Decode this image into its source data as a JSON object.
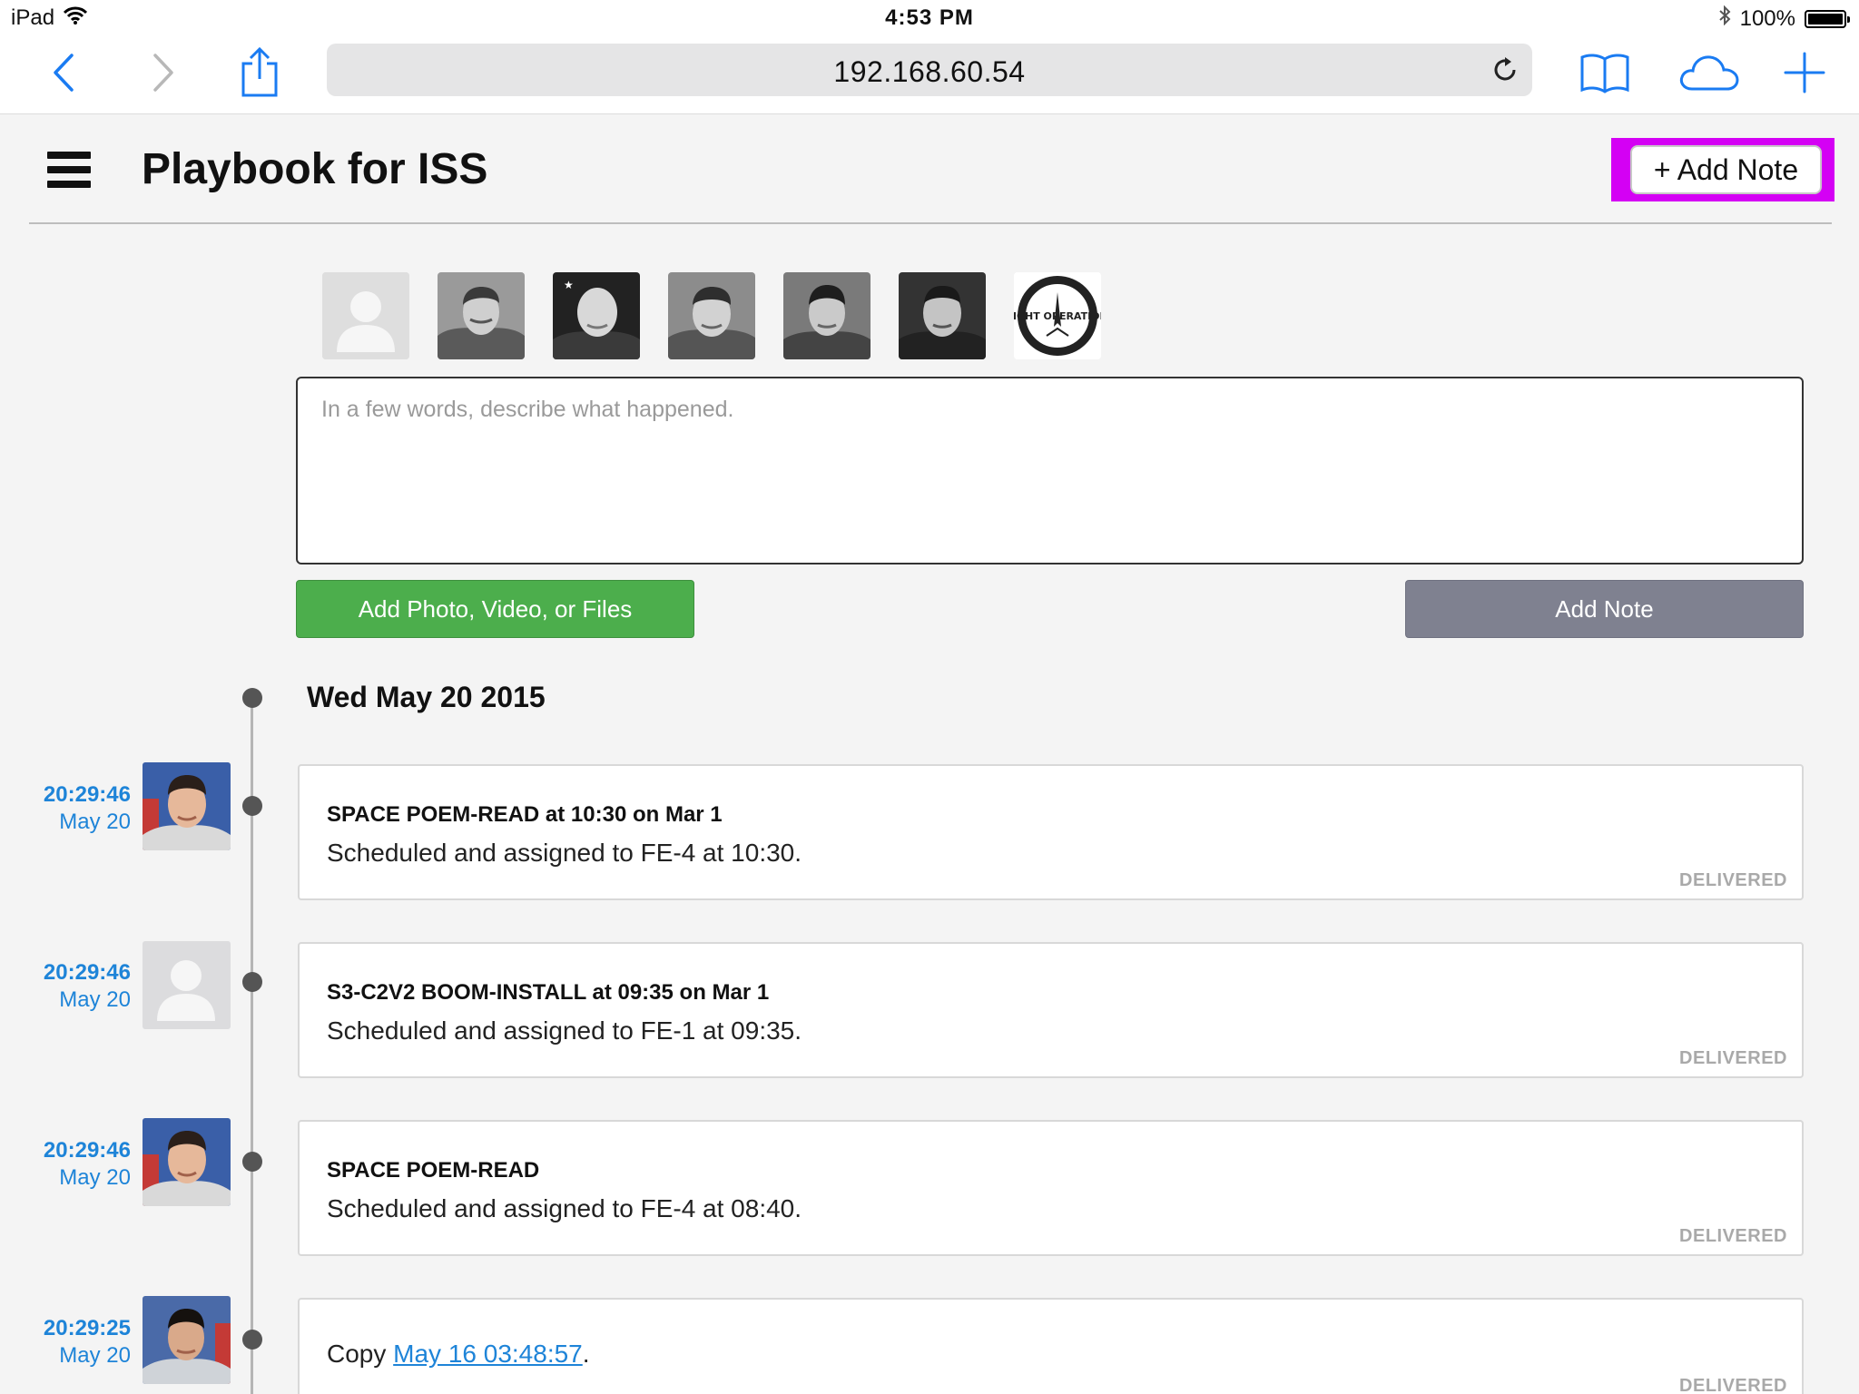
{
  "status_bar": {
    "device": "iPad",
    "time": "4:53 PM",
    "battery": "100%"
  },
  "browser": {
    "url": "192.168.60.54",
    "icons": [
      "back-icon",
      "forward-icon",
      "share-icon",
      "reload-icon",
      "bookmarks-icon",
      "icloud-tabs-icon",
      "new-tab-icon"
    ]
  },
  "header": {
    "title": "Playbook for ISS",
    "add_note_label": "+ Add Note",
    "highlight_color": "#d400f4"
  },
  "composer": {
    "crew_avatars": [
      "placeholder",
      "crew-photo",
      "crew-photo",
      "crew-photo",
      "crew-photo",
      "crew-photo",
      "flight-operations-logo"
    ],
    "logo_text": "FLIGHT OPERATIONS",
    "placeholder": "In a few words, describe what happened.",
    "media_button": "Add Photo, Video, or Files",
    "add_note_button": "Add Note",
    "media_button_color": "#4cae4c",
    "add_note_button_color": "#7f8190"
  },
  "timeline": {
    "date_heading": "Wed May 20 2015",
    "entries": [
      {
        "time": "20:29:46",
        "date": "May 20",
        "avatar": "crew-photo",
        "title": "SPACE POEM-READ at 10:30 on Mar 1",
        "body": "Scheduled and assigned to FE-4 at 10:30.",
        "status": "DELIVERED"
      },
      {
        "time": "20:29:46",
        "date": "May 20",
        "avatar": "placeholder",
        "title": "S3-C2V2 BOOM-INSTALL at 09:35 on Mar 1",
        "body": "Scheduled and assigned to FE-1 at 09:35.",
        "status": "DELIVERED"
      },
      {
        "time": "20:29:46",
        "date": "May 20",
        "avatar": "crew-photo",
        "title": "SPACE POEM-READ",
        "body": "Scheduled and assigned to FE-4 at 08:40.",
        "status": "DELIVERED"
      },
      {
        "time": "20:29:25",
        "date": "May 20",
        "avatar": "crew-photo",
        "body_prefix": "Copy",
        "body_link": "May 16 03:48:57",
        "body_suffix": ".",
        "status": "DELIVERED"
      }
    ]
  },
  "colors": {
    "accent_blue": "#1e84d8",
    "status_gray": "#a9a9a9"
  }
}
